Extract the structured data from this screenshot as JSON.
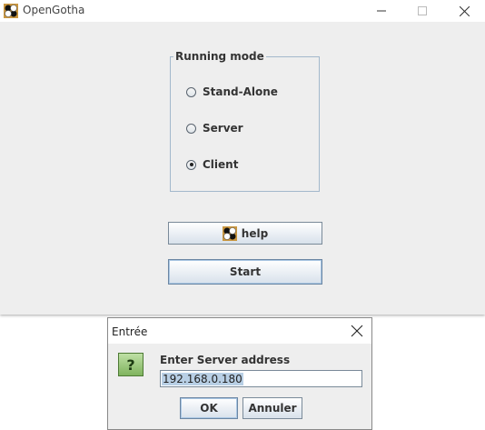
{
  "window": {
    "title": "OpenGotha",
    "controls": [
      "minimize",
      "maximize",
      "close"
    ]
  },
  "running_mode": {
    "legend": "Running mode",
    "options": [
      {
        "label": "Stand-Alone",
        "checked": false
      },
      {
        "label": "Server",
        "checked": false
      },
      {
        "label": "Client",
        "checked": true
      }
    ]
  },
  "buttons": {
    "help_label": "help",
    "start_label": "Start"
  },
  "dialog": {
    "title": "Entrée",
    "icon": "question-icon",
    "prompt": "Enter Server address",
    "input_value": "192.168.0.180",
    "ok_label": "OK",
    "cancel_label": "Annuler"
  },
  "colors": {
    "window_bg": "#eeeeee",
    "group_border": "#a3b8cc",
    "question_icon": "#7fb35e",
    "selection": "#b8cfe5"
  }
}
